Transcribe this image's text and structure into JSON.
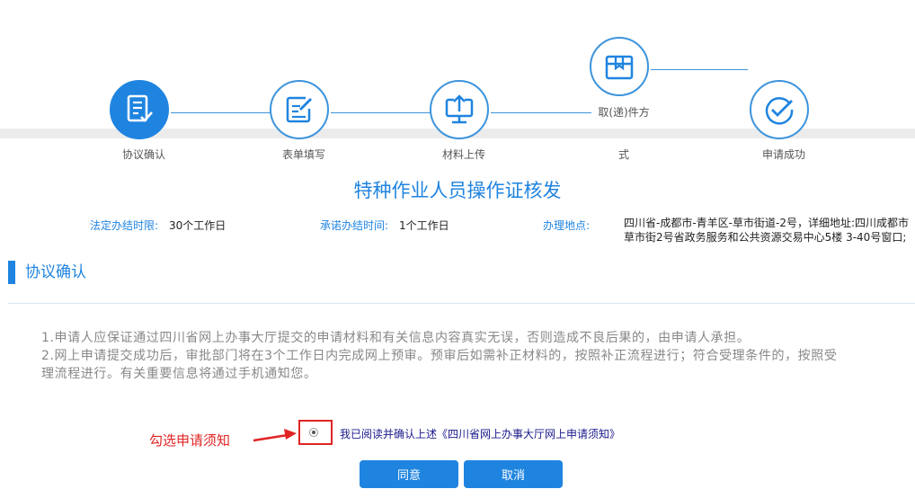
{
  "steps": [
    {
      "label": "协议确认",
      "icon": "form-check-icon",
      "active": true
    },
    {
      "label": "表单填写",
      "icon": "edit-form-icon",
      "active": false
    },
    {
      "label": "材料上传",
      "icon": "monitor-upload-icon",
      "active": false
    },
    {
      "label_line1": "取(递)件方",
      "label_line2": "式",
      "icon": "box-icon",
      "active": false
    },
    {
      "label": "申请成功",
      "icon": "checkmark-icon",
      "active": false
    }
  ],
  "page_title": "特种作业人员操作证核发",
  "info": {
    "legal_time_label": "法定办结时限:",
    "legal_time_value": "30个工作日",
    "promise_time_label": "承诺办结时间:",
    "promise_time_value": "1个工作日",
    "location_label": "办理地点:",
    "location_value": "四川省-成都市-青羊区-草市街道-2号，详细地址:四川成都市草市街2号省政务服务和公共资源交易中心5楼 3-40号窗口;"
  },
  "section_title": "协议确认",
  "notice": {
    "line1": "1.申请人应保证通过四川省网上办事大厅提交的申请材料和有关信息内容真实无误，否则造成不良后果的，由申请人承担。",
    "line2": "2.网上申请提交成功后，审批部门将在3个工作日内完成网上预审。预审后如需补正材料的，按照补正流程进行；符合受理条件的，按照受理流程进行。有关重要信息将通过手机通知您。"
  },
  "annotation": "勾选申请须知",
  "confirm_text": "我已阅读并确认上述《四川省网上办事大厅网上申请须知》",
  "buttons": {
    "agree": "同意",
    "cancel": "取消"
  },
  "colors": {
    "accent": "#1f84e0",
    "annotation": "#e02424"
  }
}
